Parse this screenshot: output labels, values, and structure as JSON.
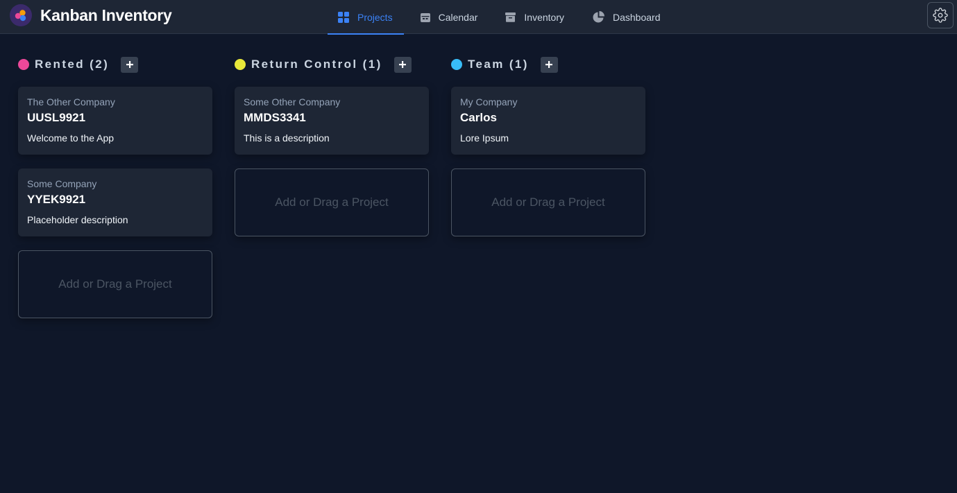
{
  "app": {
    "title": "Kanban Inventory"
  },
  "nav": {
    "items": [
      {
        "label": "Projects",
        "icon": "grid-icon",
        "active": true
      },
      {
        "label": "Calendar",
        "icon": "calendar-icon",
        "active": false
      },
      {
        "label": "Inventory",
        "icon": "box-icon",
        "active": false
      },
      {
        "label": "Dashboard",
        "icon": "pie-chart-icon",
        "active": false
      }
    ]
  },
  "settings": {
    "icon": "gear-icon"
  },
  "colors": {
    "accent": "#3b82f6",
    "background": "#0f1729",
    "surface": "#1e2635"
  },
  "columns": [
    {
      "title": "Rented",
      "count": "(2)",
      "color": "#ec4899",
      "cards": [
        {
          "company": "The Other Company",
          "code": "UUSL9921",
          "description": "Welcome to the App"
        },
        {
          "company": "Some Company",
          "code": "YYEK9921",
          "description": "Placeholder description"
        }
      ],
      "dropzone": "Add or Drag a Project"
    },
    {
      "title": "Return Control",
      "count": "(1)",
      "color": "#e8e83a",
      "cards": [
        {
          "company": "Some Other Company",
          "code": "MMDS3341",
          "description": "This is a description"
        }
      ],
      "dropzone": "Add or Drag a Project"
    },
    {
      "title": "Team",
      "count": "(1)",
      "color": "#38bdf8",
      "cards": [
        {
          "company": "My Company",
          "code": "Carlos",
          "description": "Lore Ipsum"
        }
      ],
      "dropzone": "Add or Drag a Project"
    }
  ]
}
